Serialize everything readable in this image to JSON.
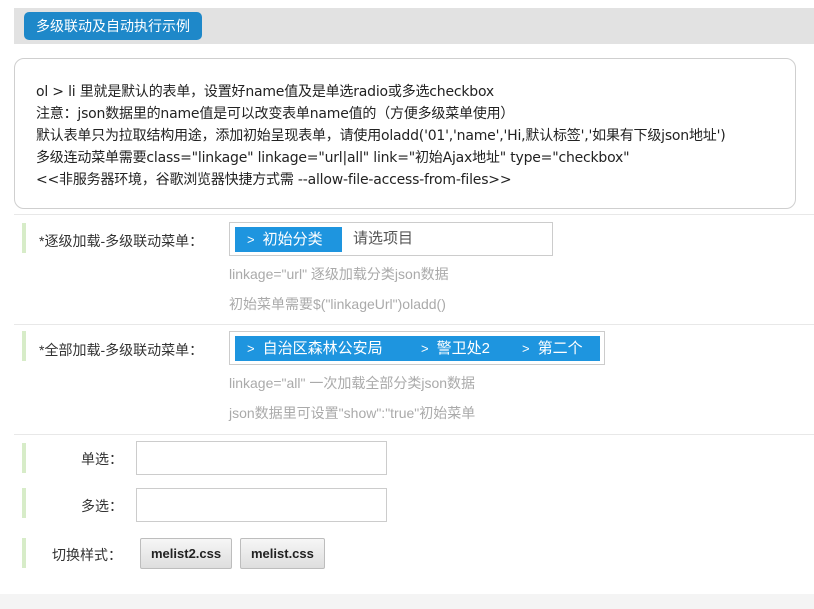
{
  "header": {
    "title": "多级联动及自动执行示例"
  },
  "info": {
    "lines": [
      "ol > li 里就是默认的表单，设置好name值及是单选radio或多选checkbox",
      "注意：json数据里的name值是可以改变表单name值的（方便多级菜单使用）",
      "默认表单只为拉取结构用途，添加初始呈现表单，请使用oladd('01','name','Hi,默认标签','如果有下级json地址')",
      "多级连动菜单需要class=\"linkage\" linkage=\"url|all\" link=\"初始Ajax地址\" type=\"checkbox\"",
      "<<非服务器环境，谷歌浏览器快捷方式需 --allow-file-access-from-files>>"
    ]
  },
  "row1": {
    "label": "*逐级加载-多级联动菜单：",
    "chip": "初始分类",
    "placeholder": "请选项目",
    "hint1": "linkage=\"url\" 逐级加载分类json数据",
    "hint2": "初始菜单需要$(\"linkageUrl\")oladd()"
  },
  "row2": {
    "label": "*全部加载-多级联动菜单：",
    "chips": [
      "自治区森林公安局",
      "警卫处2",
      "第二个"
    ],
    "hint1": "linkage=\"all\" 一次加载全部分类json数据",
    "hint2": "json数据里可设置\"show\":\"true\"初始菜单"
  },
  "radio": {
    "label": "单选：",
    "value": ""
  },
  "checkbox": {
    "label": "多选：",
    "value": ""
  },
  "style_switch": {
    "label": "切换样式：",
    "buttons": [
      "melist2.css",
      "melist.css"
    ]
  },
  "colors": {
    "accent": "#1e88c9",
    "chip": "#1e95df",
    "row_bar": "#d7ecc8"
  }
}
